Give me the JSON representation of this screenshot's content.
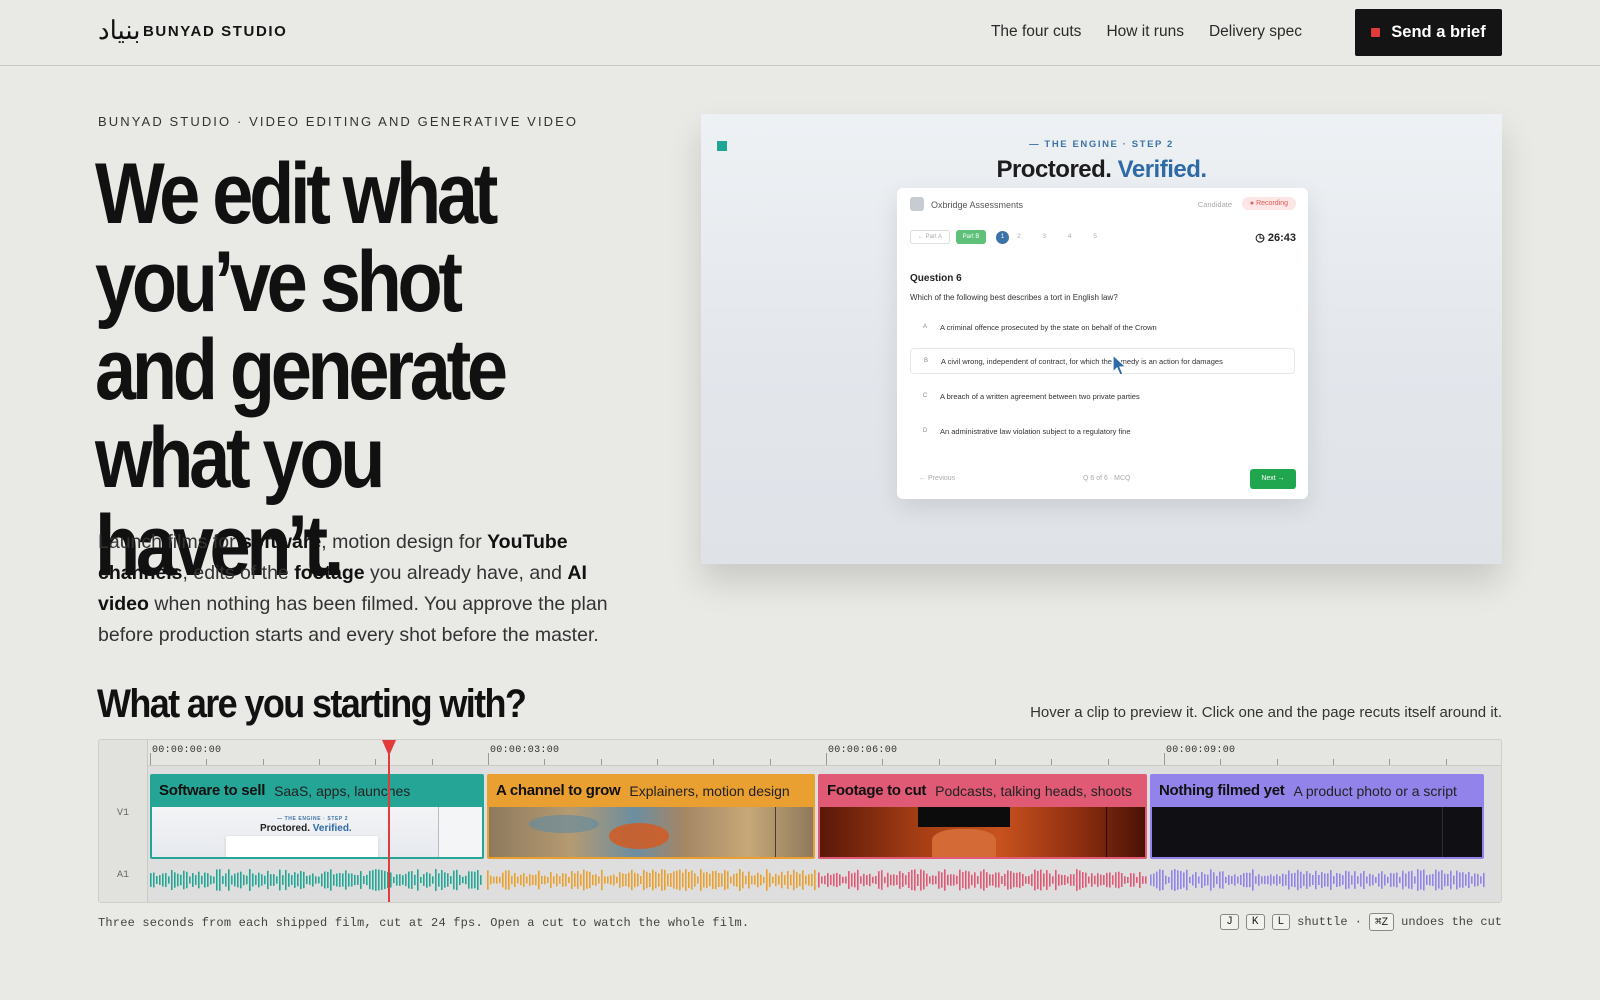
{
  "nav": {
    "logo_glyph": "بنیاد",
    "brand": "BUNYAD STUDIO",
    "links": [
      "The four cuts",
      "How it runs",
      "Delivery spec"
    ],
    "cta": "Send a brief",
    "cta_dot_color": "#e23b3b"
  },
  "hero": {
    "eyebrow": "BUNYAD STUDIO · VIDEO EDITING AND GENERATIVE VIDEO",
    "headline": "We edit what you’ve shot and generate what you haven’t.",
    "lede": {
      "p1": "Launch films for ",
      "b1": "software",
      "p2": ", motion design for ",
      "b2": "YouTube channels",
      "p3": ", edits of the ",
      "b3": "footage",
      "p4": " you already have, and ",
      "b4": "AI video",
      "p5": " when nothing has been filmed. You approve the plan before production starts and every shot before the master."
    }
  },
  "preview": {
    "step": "— THE ENGINE · STEP 2",
    "title_a": "Proctored.",
    "title_b": "Verified.",
    "card": {
      "org": "Oxbridge Assessments",
      "candidate": "Candidate",
      "recording": "● Recording",
      "pill1": "← Part A",
      "pill2": "Part B",
      "current_q": "1",
      "other_qs": "2 3 4 5",
      "timer": "◷ 26:43",
      "question_label": "Question 6",
      "question_text": "Which of the following best describes a tort in English law?",
      "options": [
        {
          "letter": "A",
          "text": "A criminal offence prosecuted by the state on behalf of the Crown"
        },
        {
          "letter": "B",
          "text": "A civil wrong, independent of contract, for which the remedy is an action for damages"
        },
        {
          "letter": "C",
          "text": "A breach of a written agreement between two private parties"
        },
        {
          "letter": "D",
          "text": "An administrative law violation subject to a regulatory fine"
        }
      ],
      "prev": "← Previous",
      "mid": "Q 6 of 6 · MCQ",
      "next": "Next →"
    }
  },
  "section": {
    "title": "What are you starting with?",
    "hint": "Hover a clip to preview it. Click one and the page recuts itself around it."
  },
  "timeline": {
    "timecodes": [
      "00:00:00:00",
      "00:00:03:00",
      "00:00:06:00",
      "00:00:09:00"
    ],
    "tracks": [
      "V1",
      "A1"
    ],
    "clips": [
      {
        "title": "Software to sell",
        "subtitle": "SaaS, apps, launches",
        "color": "#25a596"
      },
      {
        "title": "A channel to grow",
        "subtitle": "Explainers, motion design",
        "color": "#e9a030"
      },
      {
        "title": "Footage to cut",
        "subtitle": "Podcasts, talking heads, shoots",
        "color": "#e05a75"
      },
      {
        "title": "Nothing filmed yet",
        "subtitle": "A product photo or a script",
        "color": "#9283ea"
      }
    ],
    "playhead_color": "#e23b3b"
  },
  "footer": {
    "note": "Three seconds from each shipped film, cut at 24 fps. Open a cut to watch the whole film.",
    "keys": [
      "J",
      "K",
      "L"
    ],
    "shuttle": "shuttle ·",
    "undo_key": "⌘Z",
    "undo_text": "undoes the cut"
  }
}
